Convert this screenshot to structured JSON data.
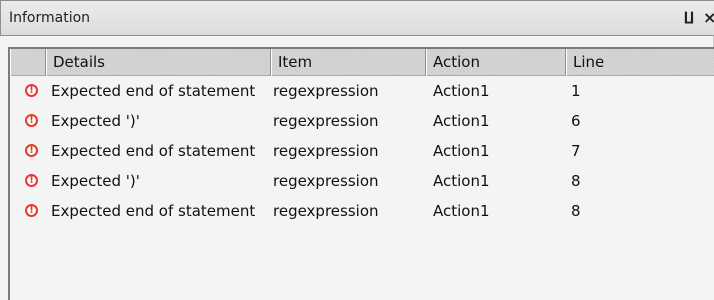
{
  "panel": {
    "title": "Information",
    "pin_label": "∐",
    "close_label": "×"
  },
  "table": {
    "columns": [
      "",
      "Details",
      "Item",
      "Action",
      "Line"
    ],
    "rows": [
      {
        "icon": "error-icon",
        "icon_glyph": "!",
        "details": "Expected end of statement",
        "item": "regexpression",
        "action": "Action1",
        "line": "1"
      },
      {
        "icon": "error-icon",
        "icon_glyph": "!",
        "details": "Expected ')'",
        "item": "regexpression",
        "action": "Action1",
        "line": "6"
      },
      {
        "icon": "error-icon",
        "icon_glyph": "!",
        "details": "Expected end of statement",
        "item": "regexpression",
        "action": "Action1",
        "line": "7"
      },
      {
        "icon": "error-icon",
        "icon_glyph": "!",
        "details": "Expected ')'",
        "item": "regexpression",
        "action": "Action1",
        "line": "8"
      },
      {
        "icon": "error-icon",
        "icon_glyph": "!",
        "details": "Expected end of statement",
        "item": "regexpression",
        "action": "Action1",
        "line": "8"
      }
    ]
  },
  "colors": {
    "error_icon": "#e33b2f",
    "panel_background": "#f3f3f3",
    "header_background": "#d2d2d2"
  }
}
